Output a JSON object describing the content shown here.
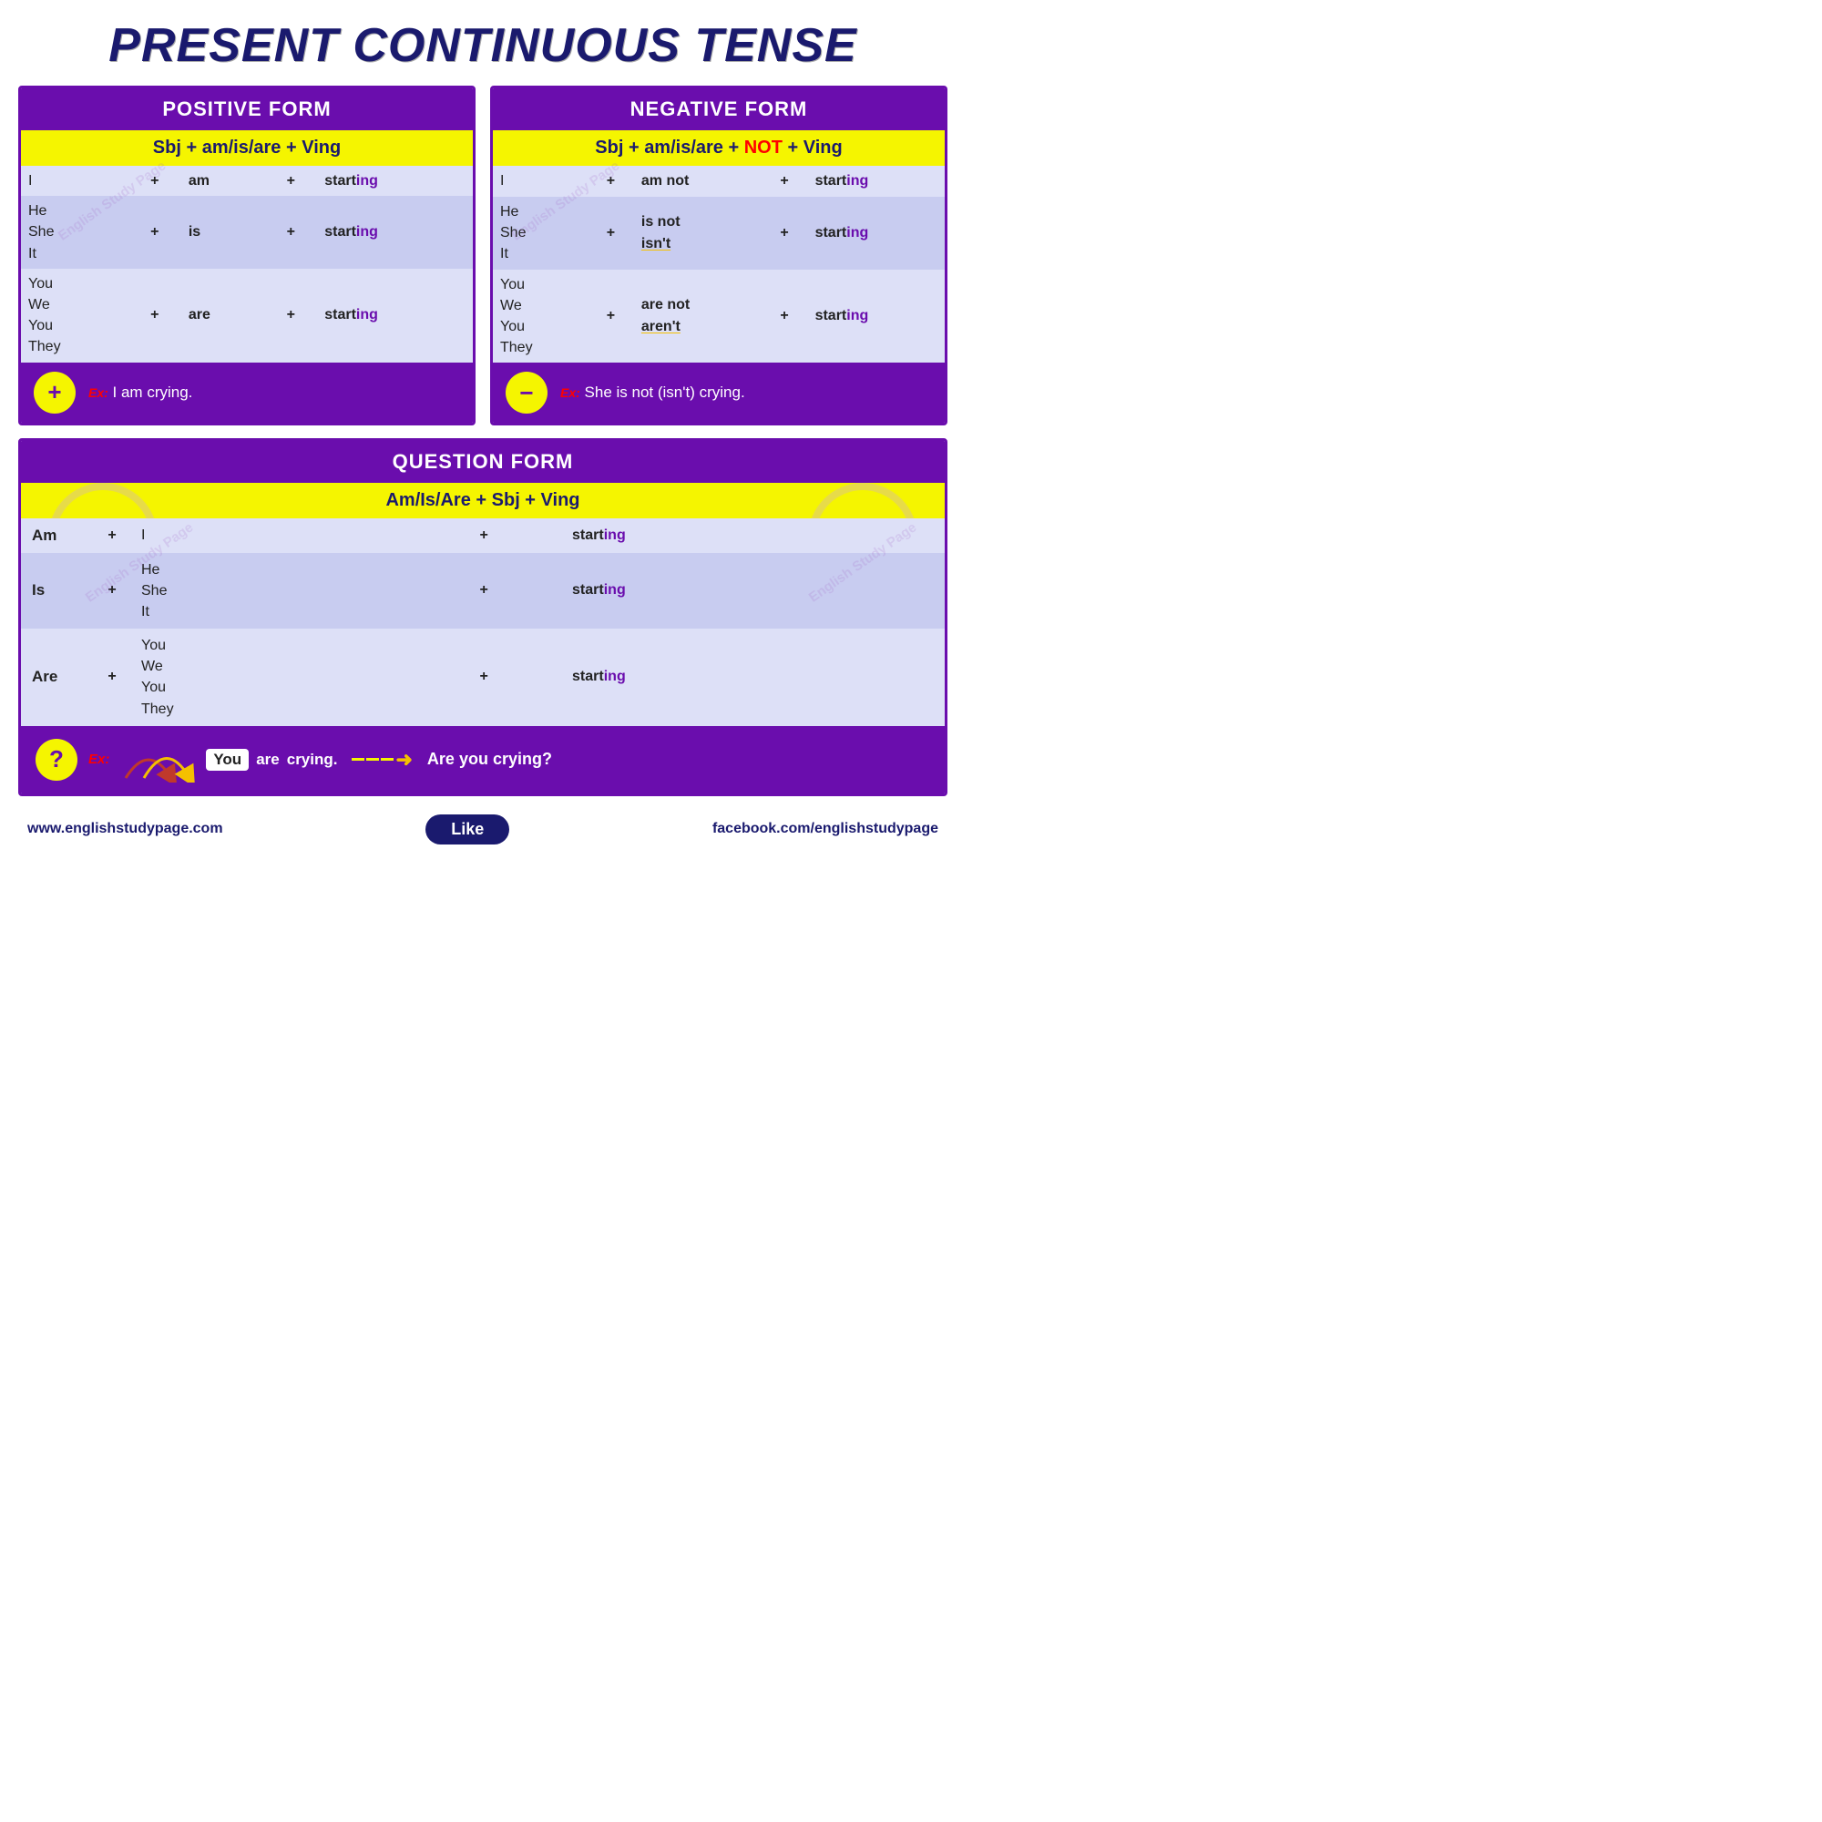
{
  "title": "PRESENT CONTINUOUS TENSE",
  "positive": {
    "header": "POSITIVE FORM",
    "formula": "Sbj + am/is/are + Ving",
    "rows": [
      {
        "subject": "I",
        "plus": "+",
        "verb": "am",
        "plus2": "+",
        "word": "start",
        "ing": "ing"
      },
      {
        "subject": "He\nShe\nIt",
        "plus": "+",
        "verb": "is",
        "plus2": "+",
        "word": "start",
        "ing": "ing"
      },
      {
        "subject": "You\nWe\nYou\nThey",
        "plus": "+",
        "verb": "are",
        "plus2": "+",
        "word": "start",
        "ing": "ing"
      }
    ],
    "example_badge": "+",
    "example_label": "Ex:",
    "example_text": "I am crying."
  },
  "negative": {
    "header": "NEGATIVE FORM",
    "formula_base": "Sbj + am/is/are + ",
    "formula_not": "NOT",
    "formula_end": " + Ving",
    "rows": [
      {
        "subject": "I",
        "plus": "+",
        "verb": "am not",
        "verb2": "",
        "plus2": "+",
        "word": "start",
        "ing": "ing"
      },
      {
        "subject": "He\nShe\nIt",
        "plus": "+",
        "verb": "is not",
        "verb2": "isn't",
        "plus2": "+",
        "word": "start",
        "ing": "ing"
      },
      {
        "subject": "You\nWe\nYou\nThey",
        "plus": "+",
        "verb": "are not",
        "verb2": "aren't",
        "plus2": "+",
        "word": "start",
        "ing": "ing"
      }
    ],
    "example_badge": "−",
    "example_label": "Ex:",
    "example_text": "She is not (isn't) crying."
  },
  "question": {
    "header": "QUESTION FORM",
    "formula": "Am/Is/Are +  Sbj + Ving",
    "rows": [
      {
        "aux": "Am",
        "plus": "+",
        "subject": "I",
        "plus2": "+",
        "word": "start",
        "ing": "ing"
      },
      {
        "aux": "Is",
        "plus": "+",
        "subject": "He\nShe\nIt",
        "plus2": "+",
        "word": "start",
        "ing": "ing"
      },
      {
        "aux": "Are",
        "plus": "+",
        "subject": "You\nWe\nYou\nThey",
        "plus2": "+",
        "word": "start",
        "ing": "ing"
      }
    ],
    "example_badge": "?",
    "example_label": "Ex:",
    "you_label": "You",
    "are_label": "are",
    "crying_label": "crying.",
    "arrow_text": "→",
    "result_text": "Are you crying?"
  },
  "footer": {
    "left": "www.englishstudypage.com",
    "like": "Like",
    "right": "facebook.com/englishstudypage"
  }
}
